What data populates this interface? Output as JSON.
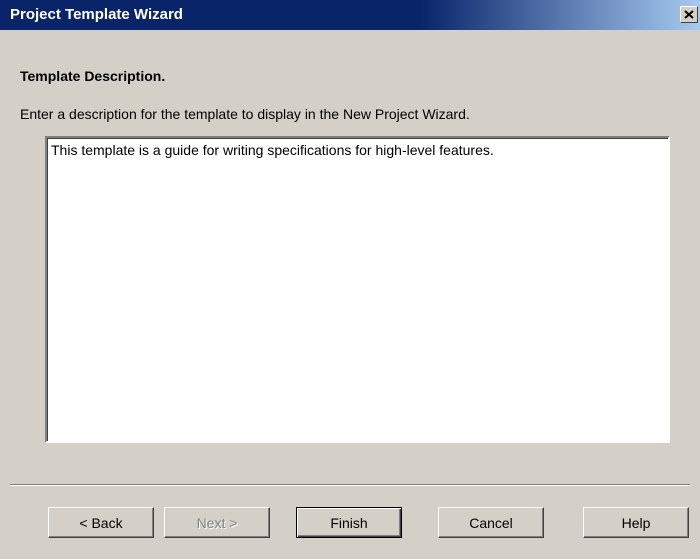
{
  "window": {
    "title": "Project Template Wizard",
    "close_icon": "close-icon"
  },
  "page": {
    "heading": "Template Description.",
    "instructions": "Enter a description for the template to display in the New Project Wizard.",
    "description_value": "This template is a guide for writing specifications for high-level features."
  },
  "buttons": {
    "back": "< Back",
    "next": "Next >",
    "finish": "Finish",
    "cancel": "Cancel",
    "help": "Help"
  },
  "colors": {
    "titlebar_active": "#0a246a",
    "dialog_face": "#d4d0c8"
  }
}
